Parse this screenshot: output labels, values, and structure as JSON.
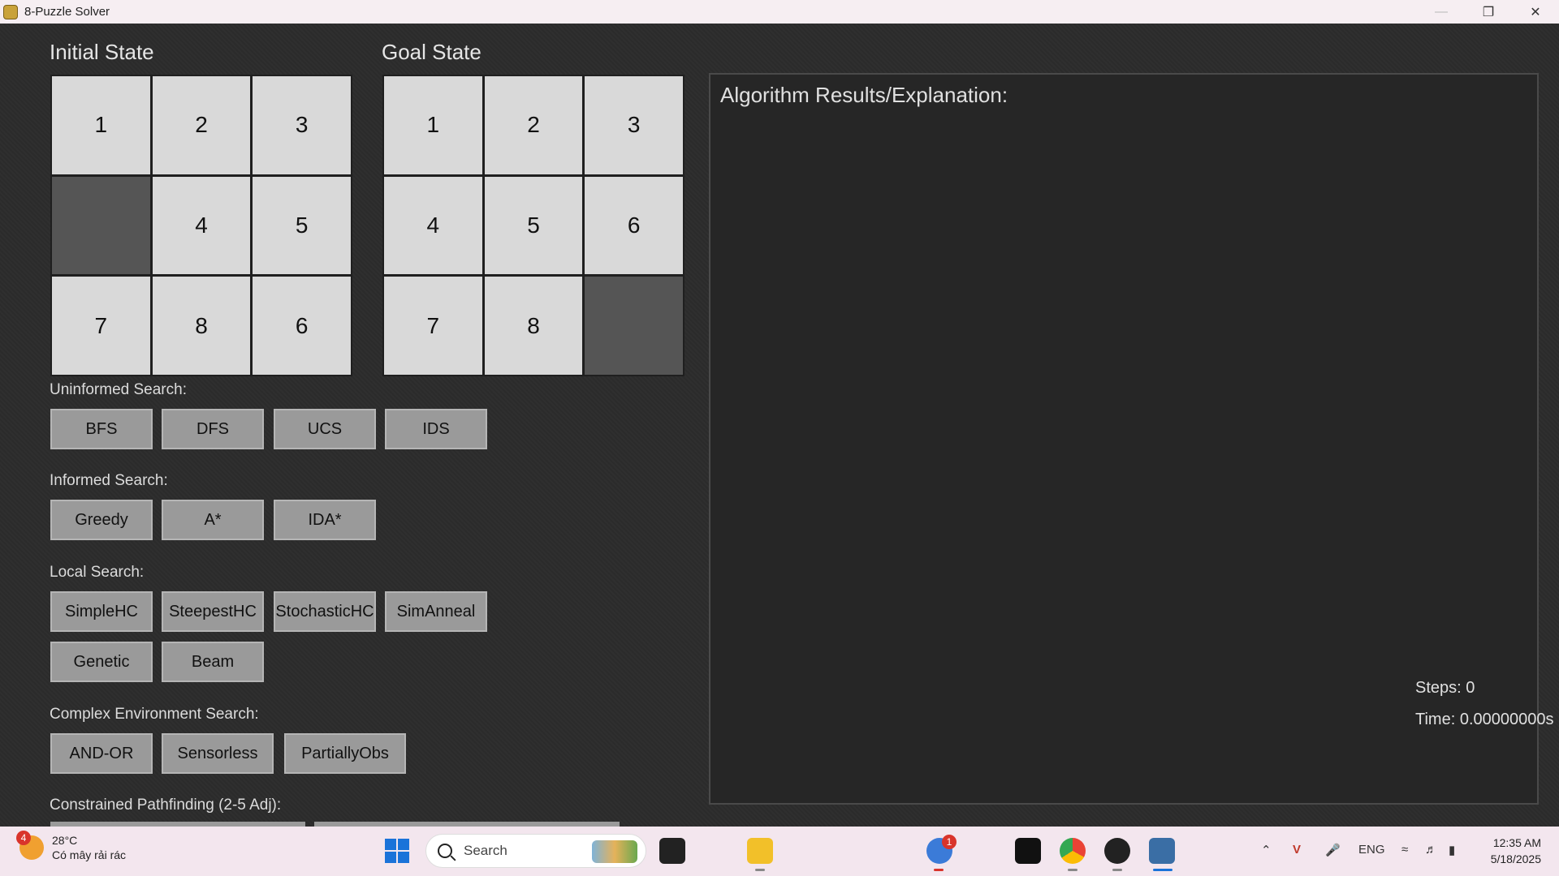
{
  "window": {
    "title": "8-Puzzle Solver"
  },
  "initial": {
    "title": "Initial State",
    "tiles": [
      "1",
      "2",
      "3",
      "",
      "4",
      "5",
      "7",
      "8",
      "6"
    ]
  },
  "goal": {
    "title": "Goal State",
    "tiles": [
      "1",
      "2",
      "3",
      "4",
      "5",
      "6",
      "7",
      "8",
      ""
    ]
  },
  "groups": {
    "uninformed": {
      "label": "Uninformed Search:",
      "buttons": [
        "BFS",
        "DFS",
        "UCS",
        "IDS"
      ]
    },
    "informed": {
      "label": "Informed Search:",
      "buttons": [
        "Greedy",
        "A*",
        "IDA*"
      ]
    },
    "local": {
      "label": "Local Search:",
      "buttons": [
        "SimpleHC",
        "SteepestHC",
        "StochasticHC",
        "SimAnneal",
        "Genetic",
        "Beam"
      ]
    },
    "complex": {
      "label": "Complex Environment Search:",
      "buttons": [
        "AND-OR",
        "Sensorless",
        "PartiallyObs"
      ]
    },
    "constrained": {
      "label": "Constrained Pathfinding (2-5 Adj):"
    }
  },
  "results": {
    "heading": "Algorithm Results/Explanation:",
    "steps": "Steps: 0",
    "time": "Time: 0.00000000s"
  },
  "taskbar": {
    "weather_temp": "28°C",
    "weather_desc": "Có mây rải rác",
    "weather_badge": "4",
    "search_placeholder": "Search",
    "mail_badge": "1",
    "language": "ENG",
    "time": "12:35 AM",
    "date": "5/18/2025"
  }
}
